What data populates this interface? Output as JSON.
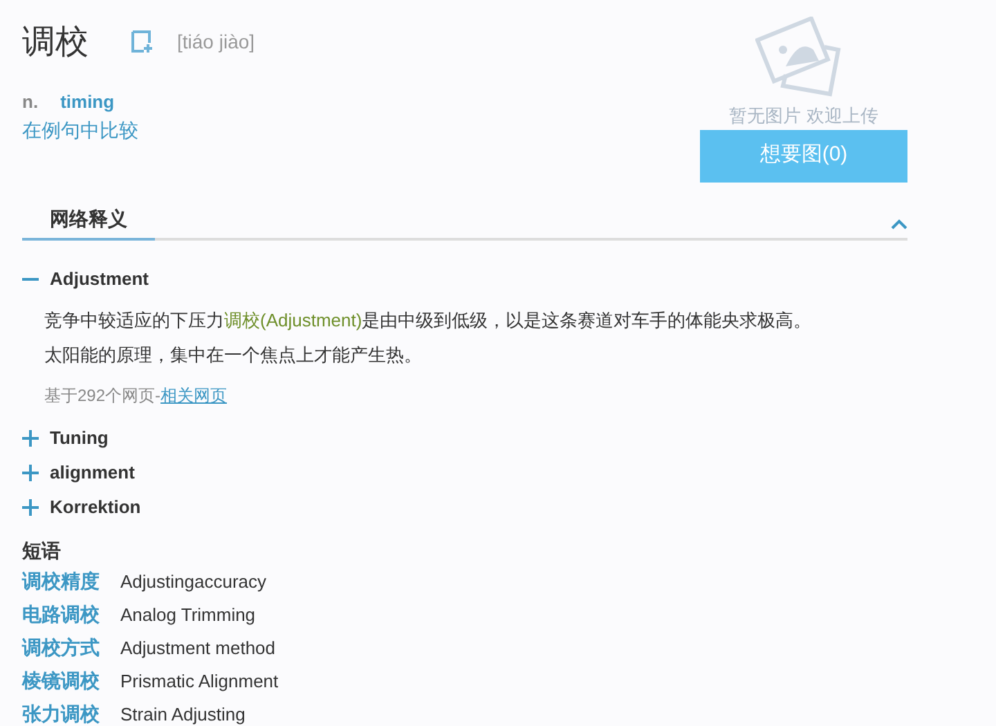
{
  "headword": {
    "text": "调校",
    "pinyin": "[tiáo jiào]"
  },
  "definition": {
    "pos": "n.",
    "translation": "timing",
    "compare_link": "在例句中比较"
  },
  "image_panel": {
    "caption": "暂无图片 欢迎上传",
    "button": "想要图(0)"
  },
  "section": {
    "tab": "网络释义",
    "expanded": true
  },
  "meanings": [
    {
      "term": "Adjustment",
      "expanded": true,
      "examples": [
        "竞争中较适应的下压力**调校(Adjustment)**是由中级到低级，以是这条赛道对车手的体能央求极高。",
        "太阳能的原理，集中在一个焦点上才能产生热。"
      ],
      "source": "基于292个网页-",
      "source_link": "相关网页"
    },
    {
      "term": "Tuning",
      "expanded": false
    },
    {
      "term": "alignment",
      "expanded": false
    },
    {
      "term": "Korrektion",
      "expanded": false
    }
  ],
  "phrases": {
    "title": "短语",
    "items": [
      {
        "zh": "调校精度",
        "en": "Adjustingaccuracy"
      },
      {
        "zh": "电路调校",
        "en": "Analog Trimming"
      },
      {
        "zh": "调校方式",
        "en": "Adjustment method"
      },
      {
        "zh": "棱镜调校",
        "en": "Prismatic Alignment"
      },
      {
        "zh": "张力调校",
        "en": "Strain Adjusting"
      }
    ]
  }
}
